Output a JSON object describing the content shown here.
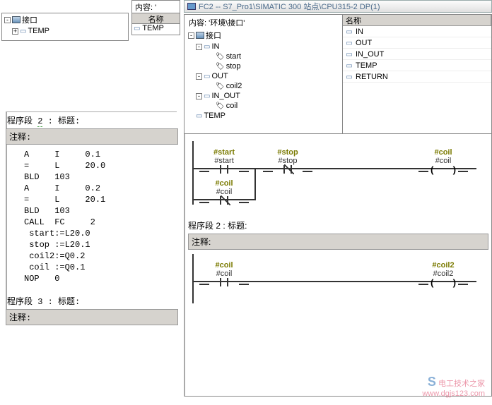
{
  "left": {
    "content_label": "内容:",
    "content_value": "'",
    "table_header": "名称",
    "tree": {
      "root": "接口",
      "temp": "TEMP"
    },
    "table_rows": [
      "TEMP"
    ],
    "seg2": {
      "title_prefix": "程序段",
      "num": "2",
      "title_sep": ":",
      "title_label": "标题:",
      "comment_label": "注释:"
    },
    "code": "A     I     0.1\n=     L     20.0\nBLD   103\nA     I     0.2\n=     L     20.1\nBLD   103\nCALL  FC     2\n start:=L20.0\n stop :=L20.1\n coil2:=Q0.2\n coil :=Q0.1\nNOP   0",
    "seg3": {
      "title_prefix": "程序段",
      "num": "3",
      "title_sep": ":",
      "title_label": "标题:",
      "comment_label": "注释:"
    }
  },
  "right": {
    "title": "FC2 -- S7_Pro1\\SIMATIC 300 站点\\CPU315-2 DP(1)",
    "content_label": "内容:",
    "content_value": "'环境\\接口'",
    "table_header": "名称",
    "tree": {
      "root": "接口",
      "in": "IN",
      "in_items": [
        "start",
        "stop"
      ],
      "out": "OUT",
      "out_items": [
        "coil2"
      ],
      "inout": "IN_OUT",
      "inout_items": [
        "coil"
      ],
      "temp": "TEMP"
    },
    "table_rows": [
      "IN",
      "OUT",
      "IN_OUT",
      "TEMP",
      "RETURN"
    ],
    "ladder1": {
      "c1": {
        "name": "#start",
        "addr": "#start",
        "type": "nopen"
      },
      "c2": {
        "name": "#stop",
        "addr": "#stop",
        "type": "nclose"
      },
      "c3": {
        "name": "#coil",
        "addr": "#coil",
        "type": "coil"
      },
      "br": {
        "name": "#coil",
        "addr": "#coil",
        "type": "nclose"
      }
    },
    "seg2": {
      "title_prefix": "程序段",
      "num": "2",
      "title_sep": ":",
      "title_label": "标题:",
      "comment_label": "注释:"
    },
    "ladder2": {
      "c1": {
        "name": "#coil",
        "addr": "#coil",
        "type": "nopen"
      },
      "c2": {
        "name": "#coil2",
        "addr": "#coil2",
        "type": "coil"
      }
    }
  },
  "watermark": {
    "brand": "电工技术之家",
    "url": "www.dgjs123.com"
  }
}
